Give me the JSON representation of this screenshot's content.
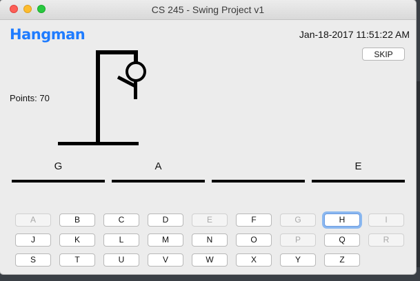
{
  "window": {
    "title": "CS 245 - Swing Project v1"
  },
  "header": {
    "app_title": "Hangman",
    "datetime": "Jan-18-2017 11:51:22 AM",
    "skip_label": "SKIP"
  },
  "score": {
    "points_text": "Points: 70"
  },
  "word_slots": [
    "G",
    "A",
    "",
    "E"
  ],
  "keyboard": {
    "rows": [
      [
        {
          "letter": "A",
          "disabled": true
        },
        {
          "letter": "B",
          "disabled": false
        },
        {
          "letter": "C",
          "disabled": false
        },
        {
          "letter": "D",
          "disabled": false
        },
        {
          "letter": "E",
          "disabled": true
        },
        {
          "letter": "F",
          "disabled": false
        },
        {
          "letter": "G",
          "disabled": true
        },
        {
          "letter": "H",
          "disabled": false,
          "focused": true
        },
        {
          "letter": "I",
          "disabled": true
        }
      ],
      [
        {
          "letter": "J",
          "disabled": false
        },
        {
          "letter": "K",
          "disabled": false
        },
        {
          "letter": "L",
          "disabled": false
        },
        {
          "letter": "M",
          "disabled": false
        },
        {
          "letter": "N",
          "disabled": false
        },
        {
          "letter": "O",
          "disabled": false
        },
        {
          "letter": "P",
          "disabled": true
        },
        {
          "letter": "Q",
          "disabled": false
        },
        {
          "letter": "R",
          "disabled": true
        }
      ],
      [
        {
          "letter": "S",
          "disabled": false
        },
        {
          "letter": "T",
          "disabled": false
        },
        {
          "letter": "U",
          "disabled": false
        },
        {
          "letter": "V",
          "disabled": false
        },
        {
          "letter": "W",
          "disabled": false
        },
        {
          "letter": "X",
          "disabled": false
        },
        {
          "letter": "Y",
          "disabled": false
        },
        {
          "letter": "Z",
          "disabled": false
        }
      ]
    ]
  },
  "colors": {
    "accent": "#1f7cff",
    "focus_ring": "#8bb8f0",
    "disabled_text": "#a8a8a8"
  }
}
